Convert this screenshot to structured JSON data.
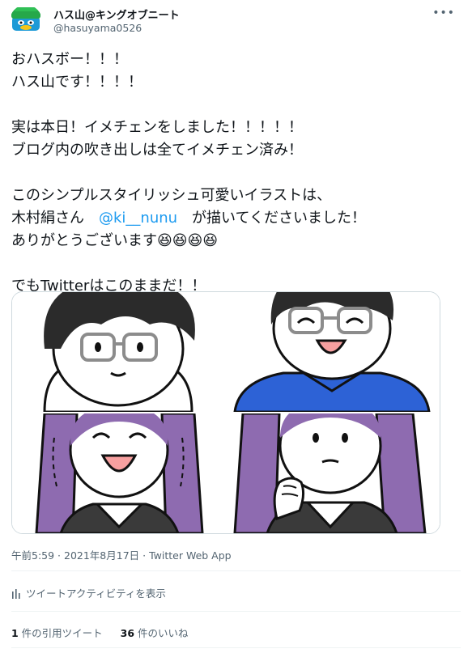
{
  "author": {
    "display_name": "ハス山@キングオブニート",
    "handle": "@hasuyama0526"
  },
  "more_label": "•••",
  "tweet": {
    "line1": "おハスボー！！！",
    "line2": "ハス山です！！！！",
    "line3": "実は本日！イメチェンをしました！！！！！",
    "line4": "ブログ内の吹き出しは全てイメチェン済み！",
    "line5": "このシンプルスタイリッシュ可愛いイラストは、",
    "line6_pre": "木村絹さん　",
    "line6_mention": "@ki__nunu",
    "line6_post": "　が描いてくださいました！",
    "line7": "ありがとうございます😆😆😆😆",
    "line8": "でもTwitterはこのままだ！！"
  },
  "meta": {
    "timestamp": "午前5:59 · 2021年8月17日 · Twitter Web App"
  },
  "activity_label": "ツイートアクティビティを表示",
  "stats": {
    "quotes_count": "1",
    "quotes_label": " 件の引用ツイート",
    "likes_count": "36",
    "likes_label": " 件のいいね"
  },
  "colors": {
    "hair_dark": "#2b2b2b",
    "hair_purple": "#8e6bb0",
    "shirt_blue": "#2d62d6",
    "mouth_pink": "#f7a0a0",
    "link_blue": "#1d9bf0"
  }
}
